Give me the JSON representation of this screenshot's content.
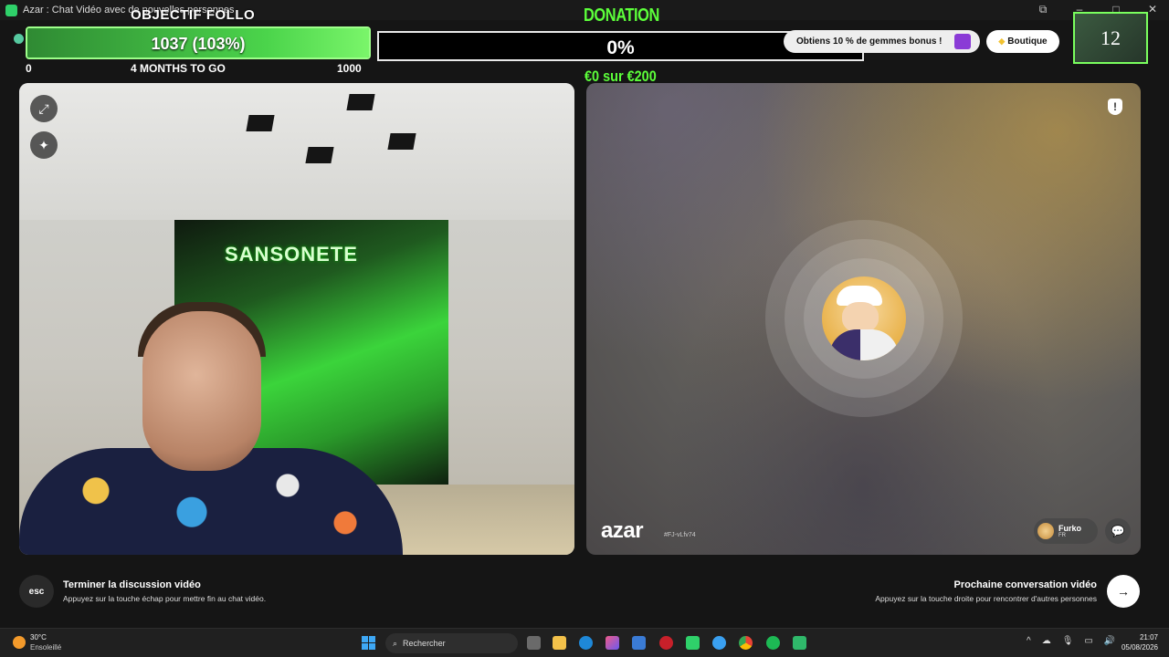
{
  "window": {
    "title": "Azar : Chat Vidéo avec de nouvelles personnes"
  },
  "follow_goal": {
    "title": "OBJECTIF FOLLO",
    "value_text": "1037 (103%)",
    "progress_percent": 103,
    "min": "0",
    "time_left": "4 MONTHS TO GO",
    "max": "1000"
  },
  "donation": {
    "title": "DONATION",
    "percent_text": "0%",
    "progress_percent": 0,
    "amount_text": "€0 sur €200"
  },
  "promo": {
    "gems_text": "Obtiens 10 % de gemmes bonus !",
    "shop_label": "Boutique"
  },
  "counter": {
    "value": "12"
  },
  "left_video": {
    "mural_text": "SANSONETE"
  },
  "right_video": {
    "logo": "azar",
    "session_id": "#FJ-vLfv74",
    "partner_name": "Furko",
    "partner_country": "FR"
  },
  "hints": {
    "esc_key": "esc",
    "end_title": "Terminer la discussion vidéo",
    "end_sub": "Appuyez sur la touche échap pour mettre fin au chat vidéo.",
    "next_title": "Prochaine conversation vidéo",
    "next_sub": "Appuyez sur la touche droite pour rencontrer d'autres personnes"
  },
  "taskbar": {
    "weather_temp": "30°C",
    "weather_desc": "Ensoleillé",
    "search_placeholder": "Rechercher",
    "time": "21:07",
    "date": "05/08/2026"
  },
  "colors": {
    "accent_green": "#5cff3a",
    "follow_border": "#9dff8a",
    "counter_border": "#7aff5e"
  }
}
